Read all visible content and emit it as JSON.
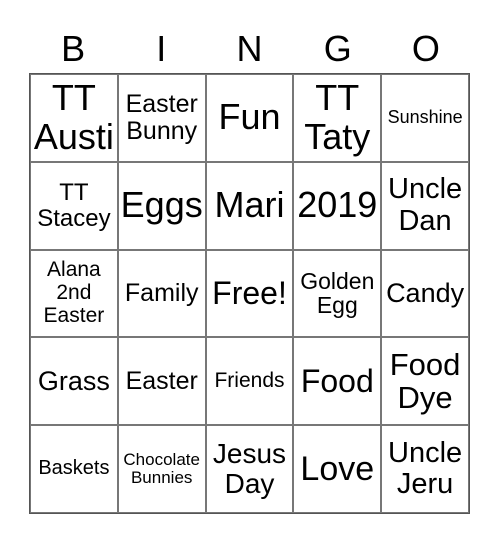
{
  "header": [
    "B",
    "I",
    "N",
    "G",
    "O"
  ],
  "cells": [
    [
      "TT Austi",
      "Easter Bunny",
      "Fun",
      "TT Taty",
      "Sunshine"
    ],
    [
      "TT Stacey",
      "Eggs",
      "Mari",
      "2019",
      "Uncle Dan"
    ],
    [
      "Alana 2nd Easter",
      "Family",
      "Free!",
      "Golden Egg",
      "Candy"
    ],
    [
      "Grass",
      "Easter",
      "Friends",
      "Food",
      "Food Dye"
    ],
    [
      "Baskets",
      "Chocolate Bunnies",
      "Jesus Day",
      "Love",
      "Uncle Jeru"
    ]
  ]
}
